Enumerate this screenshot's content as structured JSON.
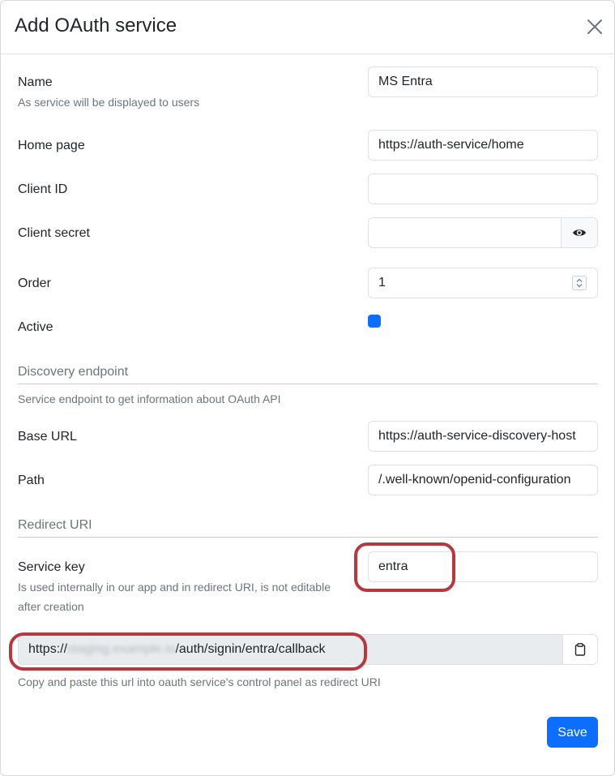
{
  "dialog": {
    "title": "Add OAuth service",
    "close_icon": "close-icon",
    "save_label": "Save"
  },
  "fields": {
    "name": {
      "label": "Name",
      "help": "As service will be displayed to users",
      "value": "MS Entra"
    },
    "home_page": {
      "label": "Home page",
      "value": "https://auth-service/home"
    },
    "client_id": {
      "label": "Client ID",
      "value": ""
    },
    "client_secret": {
      "label": "Client secret",
      "value": "",
      "toggle_icon": "eye-icon"
    },
    "order": {
      "label": "Order",
      "value": "1"
    },
    "active": {
      "label": "Active",
      "checked": true
    }
  },
  "discovery": {
    "title": "Discovery endpoint",
    "help": "Service endpoint to get information about OAuth API",
    "base_url": {
      "label": "Base URL",
      "value": "https://auth-service-discovery-host"
    },
    "path": {
      "label": "Path",
      "value": "/.well-known/openid-configuration"
    }
  },
  "redirect": {
    "title": "Redirect URI",
    "service_key": {
      "label": "Service key",
      "help_line1": "Is used internally in our app and in redirect URI, is not editable",
      "help_line2": "after creation",
      "value": "entra"
    },
    "uri": {
      "prefix": "https://",
      "obscured": "staging.example.io",
      "suffix": "/auth/signin/entra/callback",
      "help": "Copy and paste this url into oauth service's control panel as redirect URI",
      "copy_icon": "clipboard-icon"
    }
  },
  "colors": {
    "primary": "#0d6efd",
    "annotation": "#b5393f",
    "muted_text": "#6c757d",
    "readonly_bg": "#e9ecef"
  }
}
